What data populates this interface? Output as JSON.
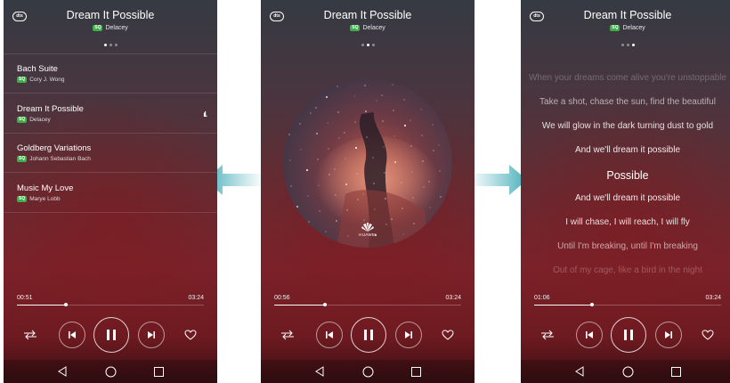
{
  "song": {
    "title": "Dream It Possible",
    "badge": "SQ",
    "artist": "Delacey"
  },
  "dts_label": "dts",
  "playlist": [
    {
      "title": "Bach Suite",
      "badge": "SQ",
      "artist": "Cory J. Wong",
      "playing": false
    },
    {
      "title": "Dream It Possible",
      "badge": "SQ",
      "artist": "Delacey",
      "playing": true
    },
    {
      "title": "Goldberg Variations",
      "badge": "SQ",
      "artist": "Johann Sebastian Bach",
      "playing": false
    },
    {
      "title": "Music My Love",
      "badge": "SQ",
      "artist": "Marye Lobb",
      "playing": false
    }
  ],
  "playing_indicator": "ıl.",
  "album_logo": "HUAWEI",
  "lyrics": [
    "When your dreams come alive you're unstoppable",
    "Take a shot, chase the sun, find the beautiful",
    "We will glow in the dark turning dust to gold",
    "And we'll dream it possible",
    "Possible",
    "And we'll dream it possible",
    "I will chase, I will reach, I will fly",
    "Until I'm breaking, until I'm breaking",
    "Out of my cage, like a bird in the night"
  ],
  "screens": [
    {
      "elapsed": "00:51",
      "total": "03:24",
      "progress": 0.26,
      "page": 0
    },
    {
      "elapsed": "00:56",
      "total": "03:24",
      "progress": 0.27,
      "page": 1
    },
    {
      "elapsed": "01:06",
      "total": "03:24",
      "progress": 0.31,
      "page": 2
    }
  ],
  "icons": {
    "dts": "dts-icon",
    "shuffle": "repeat-icon",
    "prev": "previous-icon",
    "pause": "pause-icon",
    "next": "next-icon",
    "fav": "heart-icon",
    "back": "back-icon",
    "home": "home-icon",
    "recent": "recent-apps-icon",
    "arrow": "arrow-icon"
  },
  "colors": {
    "accent": "#3fae49",
    "arrow": "#5ab9c4",
    "background_top": "#353a43",
    "background_bottom": "#6d1a20"
  }
}
